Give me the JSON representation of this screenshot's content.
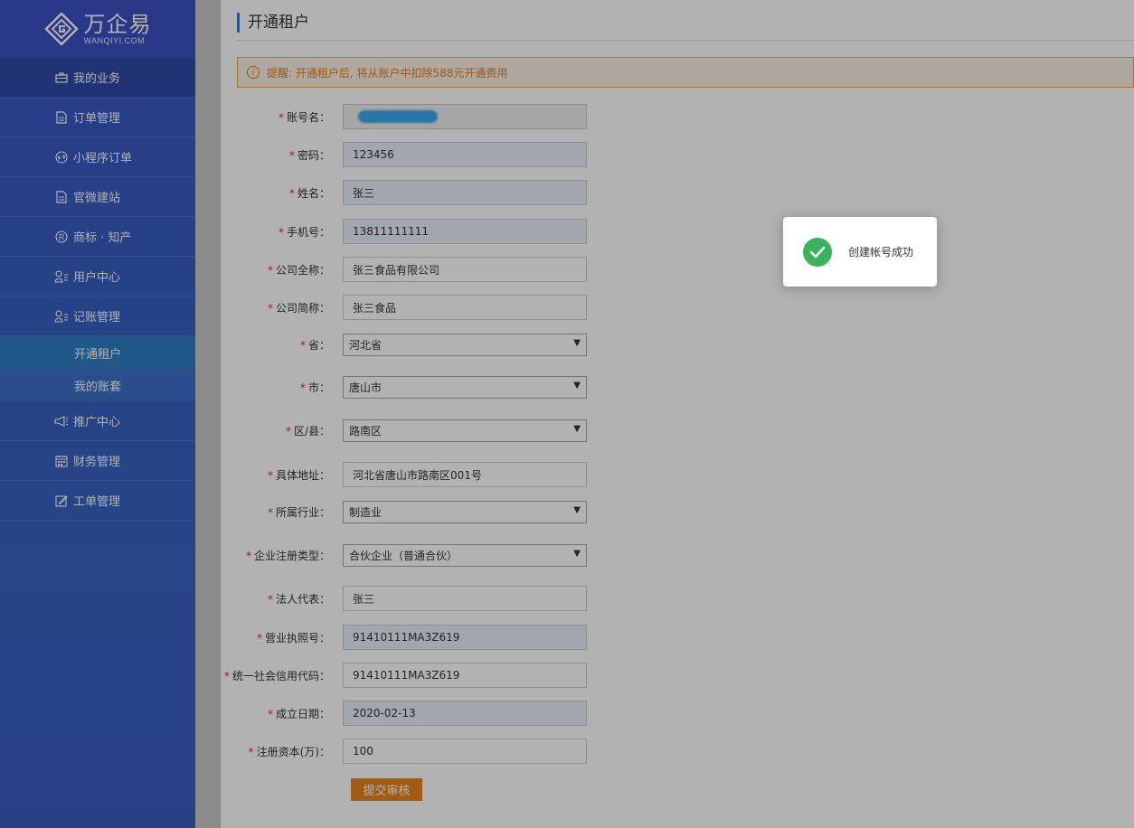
{
  "brand": {
    "name_cn": "万企易",
    "name_en": "WANQIYI.COM"
  },
  "sidebar": {
    "items": [
      {
        "label": "我的业务",
        "icon": "briefcase-icon",
        "active": true
      },
      {
        "label": "订单管理",
        "icon": "document-icon"
      },
      {
        "label": "小程序订单",
        "icon": "miniprogram-icon"
      },
      {
        "label": "官微建站",
        "icon": "document-icon"
      },
      {
        "label": "商标 · 知产",
        "icon": "registered-icon"
      },
      {
        "label": "用户中心",
        "icon": "user-icon"
      },
      {
        "label": "记账管理",
        "icon": "user-icon"
      }
    ],
    "sub_items": [
      {
        "label": "开通租户",
        "active": true
      },
      {
        "label": "我的账套"
      }
    ],
    "items_after": [
      {
        "label": "推广中心",
        "icon": "megaphone-icon"
      },
      {
        "label": "财务管理",
        "icon": "calendar-icon"
      },
      {
        "label": "工单管理",
        "icon": "edit-icon"
      }
    ]
  },
  "main": {
    "title": "开通租户",
    "notice": "提醒: 开通租户后, 将从账户中扣除588元开通费用",
    "form": {
      "account_label": "账号名：",
      "password_label": "密码：",
      "password_value": "123456",
      "name_label": "姓名：",
      "name_value": "张三",
      "phone_label": "手机号：",
      "phone_value": "13811111111",
      "company_full_label": "公司全称：",
      "company_full_value": "张三食品有限公司",
      "company_short_label": "公司简称：",
      "company_short_value": "张三食品",
      "province_label": "省：",
      "province_value": "河北省",
      "city_label": "市：",
      "city_value": "唐山市",
      "district_label": "区/县：",
      "district_value": "路南区",
      "address_label": "具体地址：",
      "address_value": "河北省唐山市路南区001号",
      "industry_label": "所属行业：",
      "industry_value": "制造业",
      "reg_type_label": "企业注册类型：",
      "reg_type_value": "合伙企业（普通合伙）",
      "legal_rep_label": "法人代表：",
      "legal_rep_value": "张三",
      "license_label": "营业执照号：",
      "license_value": "91410111MA3Z619",
      "credit_code_label": "统一社会信用代码：",
      "credit_code_value": "91410111MA3Z619",
      "established_label": "成立日期：",
      "established_value": "2020-02-13",
      "capital_label": "注册资本(万)：",
      "capital_value": "100",
      "required_mark": "*",
      "submit_label": "提交审核"
    }
  },
  "toast": {
    "message": "创建帐号成功",
    "icon": "check-circle-icon",
    "color": "#3bb25c"
  },
  "colors": {
    "sidebar": "#3a5bc3",
    "accent_orange": "#e8821f",
    "title_bar": "#3a78d6"
  }
}
